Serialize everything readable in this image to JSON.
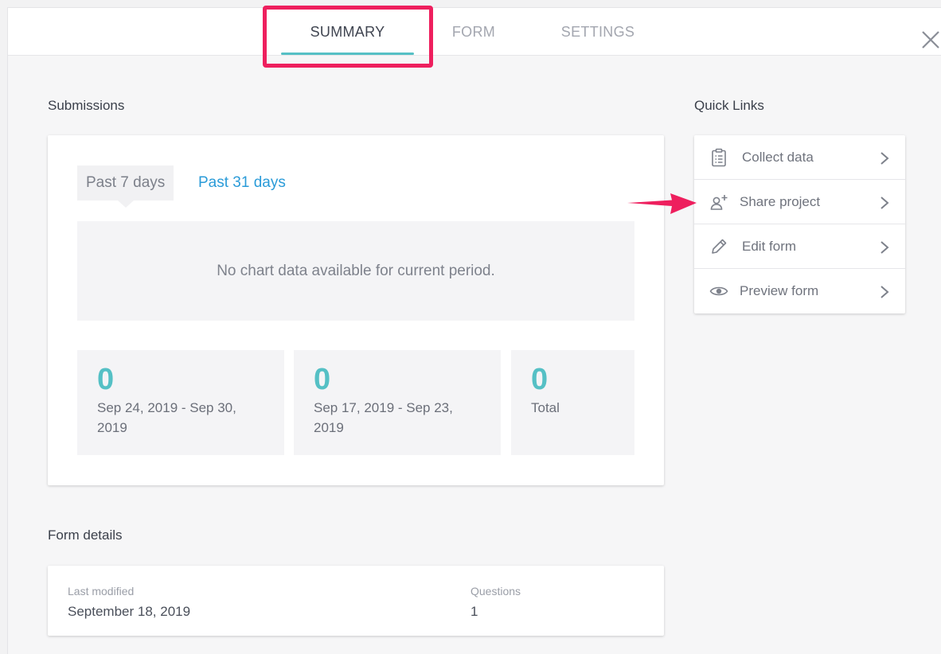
{
  "tabs": [
    {
      "label": "SUMMARY",
      "active": true
    },
    {
      "label": "FORM",
      "active": false
    },
    {
      "label": "SETTINGS",
      "active": false
    }
  ],
  "colors": {
    "accent": "#55c0c5",
    "link": "#2a9bd8",
    "highlight": "#ee1f5e"
  },
  "submissions": {
    "title": "Submissions",
    "period_tabs": [
      "Past 7 days",
      "Past 31 days"
    ],
    "empty_message": "No chart data available for current period.",
    "stats": [
      {
        "value": "0",
        "label": "Sep 24, 2019 - Sep 30, 2019"
      },
      {
        "value": "0",
        "label": "Sep 17, 2019 - Sep 23, 2019"
      },
      {
        "value": "0",
        "label": "Total"
      }
    ]
  },
  "quick_links": {
    "title": "Quick Links",
    "items": [
      {
        "label": "Collect data",
        "icon": "clipboard-icon"
      },
      {
        "label": "Share project",
        "icon": "add-user-icon"
      },
      {
        "label": "Edit form",
        "icon": "pencil-icon"
      },
      {
        "label": "Preview form",
        "icon": "eye-icon"
      }
    ]
  },
  "form_details": {
    "title": "Form details",
    "last_modified_label": "Last modified",
    "last_modified_value": "September 18, 2019",
    "questions_label": "Questions",
    "questions_value": "1"
  }
}
